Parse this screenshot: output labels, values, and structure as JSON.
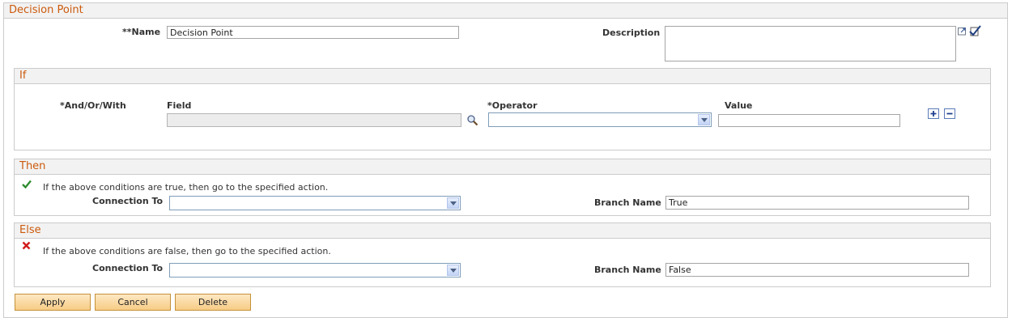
{
  "page": {
    "title": "Decision Point"
  },
  "name": {
    "label": "**Name",
    "value": "Decision Point"
  },
  "description": {
    "label": "Description",
    "value": ""
  },
  "if_section": {
    "title": "If",
    "and_or_with_label": "*And/Or/With",
    "field_label": "Field",
    "field_value": "",
    "operator_label": "*Operator",
    "operator_value": "",
    "value_label": "Value",
    "value_value": ""
  },
  "then_section": {
    "title": "Then",
    "message": "If the above conditions are true, then go to the specified action.",
    "connection_label": "Connection To",
    "connection_value": "",
    "branch_label": "Branch Name",
    "branch_value": "True"
  },
  "else_section": {
    "title": "Else",
    "message": "If the above conditions are false, then go to the specified action.",
    "connection_label": "Connection To",
    "connection_value": "",
    "branch_label": "Branch Name",
    "branch_value": "False"
  },
  "buttons": {
    "apply": "Apply",
    "cancel": "Cancel",
    "delete": "Delete"
  },
  "colors": {
    "header_text": "#cc5a0c",
    "button_border": "#c4913b",
    "check": "#2e8b2e",
    "cross": "#d11a1a"
  },
  "icons": [
    "expand-icon",
    "spellcheck-icon",
    "lookup-icon",
    "add-row-icon",
    "delete-row-icon",
    "check-icon",
    "cross-icon"
  ]
}
